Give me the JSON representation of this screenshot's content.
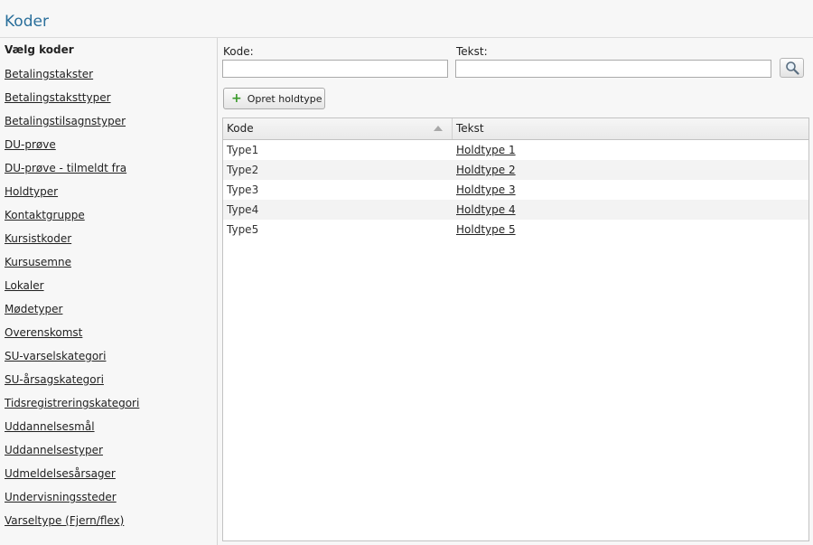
{
  "header": {
    "title": "Koder"
  },
  "sidebar": {
    "heading": "Vælg koder",
    "items": [
      "Betalingstakster",
      "Betalingstaksttyper",
      "Betalingstilsagnstyper",
      "DU-prøve",
      "DU-prøve - tilmeldt fra",
      "Holdtyper",
      "Kontaktgruppe",
      "Kursistkoder",
      "Kursusemne",
      "Lokaler",
      "Mødetyper",
      "Overenskomst",
      "SU-varselskategori",
      "SU-årsagskategori",
      "Tidsregistreringskategori",
      "Uddannelsesmål",
      "Uddannelsestyper",
      "Udmeldelsesårsager",
      "Undervisningssteder",
      "Varseltype (Fjern/flex)"
    ]
  },
  "filters": {
    "kode_label": "Kode:",
    "kode_value": "",
    "tekst_label": "Tekst:",
    "tekst_value": "",
    "search_icon": "magnifier-icon"
  },
  "toolbar": {
    "create_label": "Opret holdtype",
    "create_icon": "plus-icon"
  },
  "grid": {
    "columns": [
      "Kode",
      "Tekst"
    ],
    "sort": {
      "column": "Kode",
      "direction": "ascending"
    },
    "rows": [
      {
        "kode": "Type1",
        "tekst": "Holdtype 1"
      },
      {
        "kode": "Type2",
        "tekst": "Holdtype 2"
      },
      {
        "kode": "Type3",
        "tekst": "Holdtype 3"
      },
      {
        "kode": "Type4",
        "tekst": "Holdtype 4"
      },
      {
        "kode": "Type5",
        "tekst": "Holdtype 5"
      }
    ]
  },
  "colors": {
    "title": "#2a6f9b",
    "plus": "#3a9a2a",
    "panel_bg": "#f7f7f7"
  }
}
